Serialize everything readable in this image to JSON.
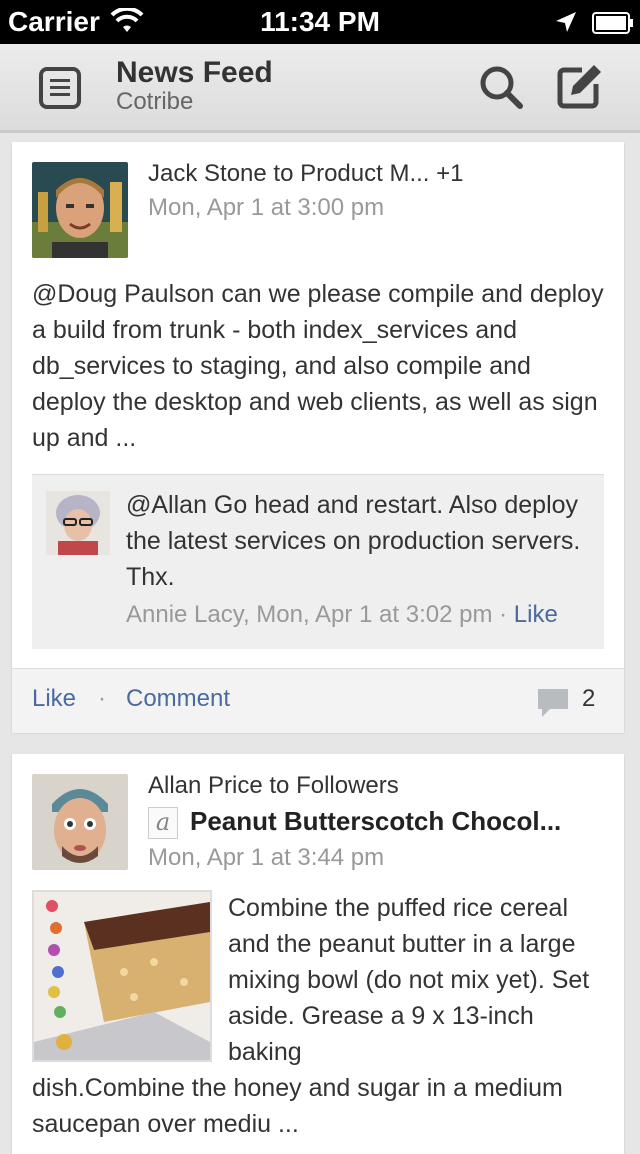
{
  "status_bar": {
    "carrier": "Carrier",
    "time": "11:34 PM"
  },
  "nav_bar": {
    "title": "News Feed",
    "subtitle": "Cotribe"
  },
  "feed": {
    "post1": {
      "author": "Jack Stone to Product M... +1",
      "timestamp": "Mon, Apr 1 at 3:00 pm",
      "body": "@Doug Paulson can we please compile and deploy a build from trunk - both index_services and db_services to staging, and also compile and deploy the desktop and web clients, as well as sign up and ...",
      "reply": {
        "text": "@Allan Go head and restart. Also deploy the latest services on production servers. Thx.",
        "meta": "Annie Lacy, Mon, Apr 1 at 3:02 pm",
        "separator": " · ",
        "like_label": "Like"
      },
      "actions": {
        "like_label": "Like",
        "dot": "·",
        "comment_label": "Comment",
        "comment_count": "2"
      }
    },
    "post2": {
      "author": "Allan Price to Followers",
      "doc_icon": "a",
      "title": "Peanut Butterscotch Chocol...",
      "timestamp": "Mon, Apr 1 at 3:44 pm",
      "body_right": "Combine the puffed rice cereal and the peanut butter in a large mixing bowl (do not mix yet).  Set aside.  Grease a 9 x 13-inch baking",
      "body_bottom": "dish.Combine the honey and sugar in a medium saucepan over mediu ..."
    }
  },
  "colors": {
    "link": "#4a6aa0",
    "muted": "#999999",
    "text": "#333333"
  }
}
